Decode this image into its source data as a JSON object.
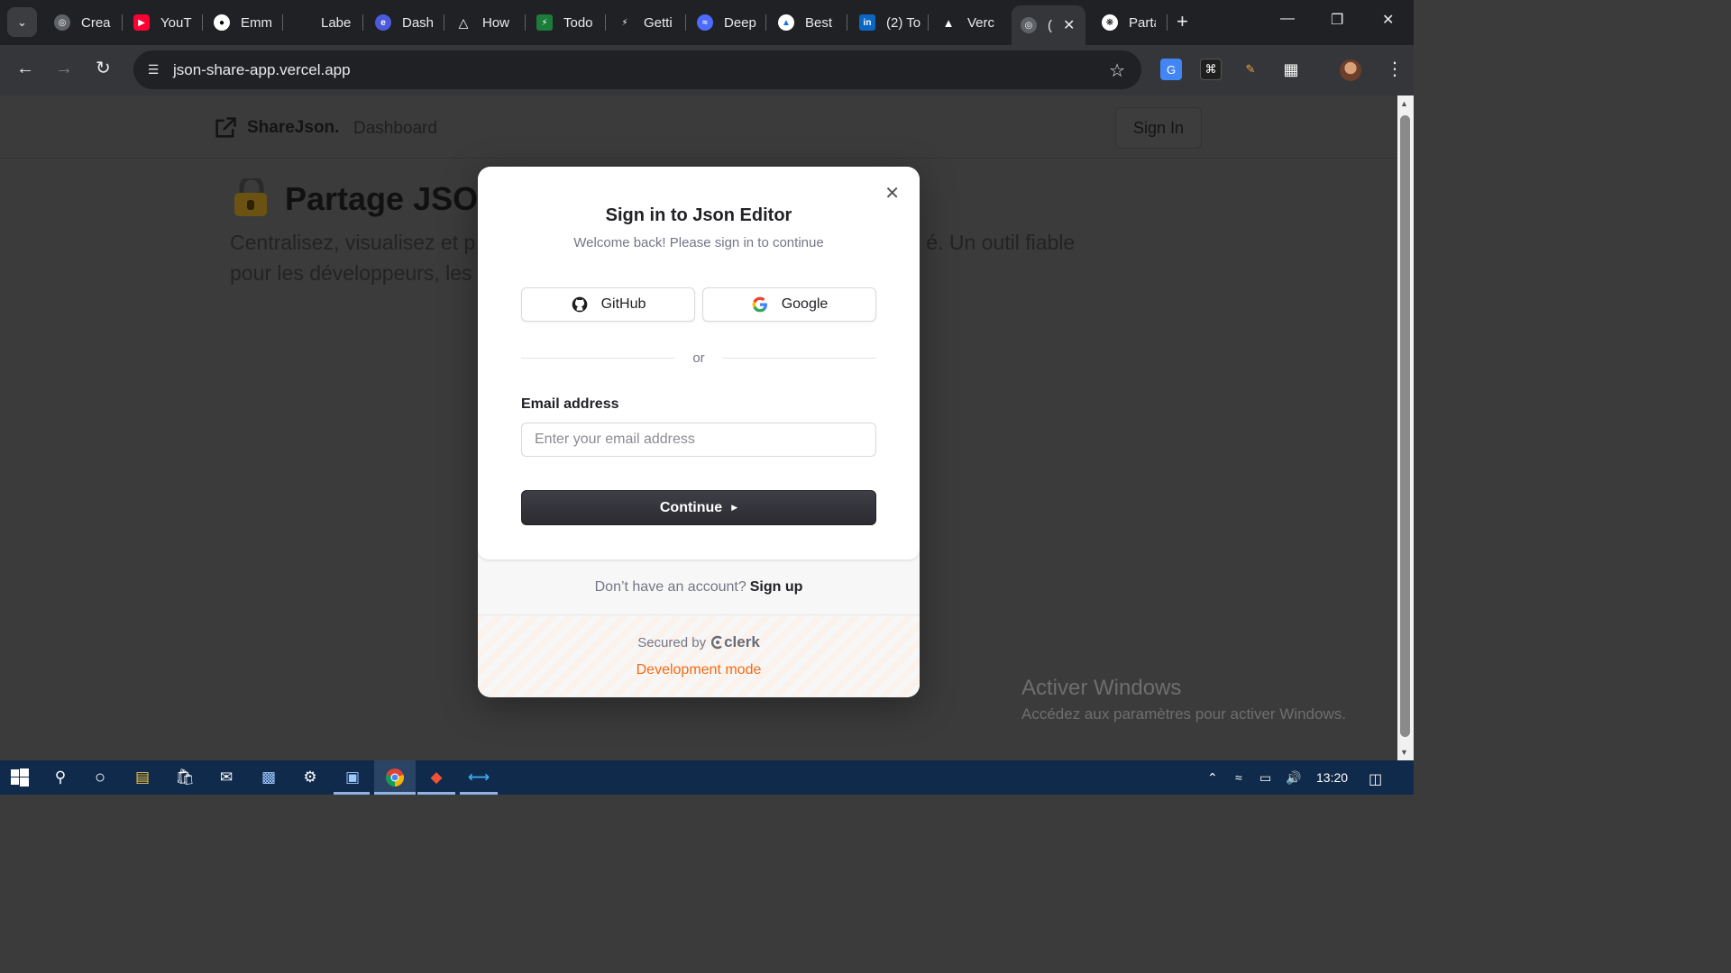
{
  "browser": {
    "tabs": [
      {
        "label": "Crea",
        "icon": "globe-icon"
      },
      {
        "label": "YouT",
        "icon": "youtube-icon"
      },
      {
        "label": "Emm",
        "icon": "github-icon"
      },
      {
        "label": "Labe",
        "icon": "blank-icon"
      },
      {
        "label": "Dash",
        "icon": "dash-icon"
      },
      {
        "label": "How",
        "icon": "triangle-icon"
      },
      {
        "label": "Todo",
        "icon": "bolt-icon"
      },
      {
        "label": "Getti",
        "icon": "bolt-icon"
      },
      {
        "label": "Deep",
        "icon": "deepseek-icon"
      },
      {
        "label": "Best",
        "icon": "drive-icon"
      },
      {
        "label": "(2) To",
        "icon": "linkedin-icon"
      },
      {
        "label": "Verc",
        "icon": "vercel-icon"
      },
      {
        "label": "(",
        "icon": "globe-icon",
        "active": true
      },
      {
        "label": "Parta",
        "icon": "openai-icon"
      }
    ],
    "url": "json-share-app.vercel.app"
  },
  "site": {
    "brand": "ShareJson.",
    "nav_dashboard": "Dashboard",
    "signin": "Sign In",
    "hero_title": "Partage JSON",
    "hero_desc_line1": "Centralisez, visualisez et p",
    "hero_desc_line1_end": "é. Un outil fiable",
    "hero_desc_line2": "pour les développeurs, les"
  },
  "modal": {
    "title": "Sign in to Json Editor",
    "subtitle": "Welcome back! Please sign in to continue",
    "github_label": "GitHub",
    "google_label": "Google",
    "divider": "or",
    "email_label": "Email address",
    "email_placeholder": "Enter your email address",
    "email_value": "",
    "continue_label": "Continue",
    "no_account": "Don’t have an account?",
    "signup_link": "Sign up",
    "secured_by": "Secured by",
    "clerk": "clerk",
    "dev_mode": "Development mode"
  },
  "watermark": {
    "title": "Activer Windows",
    "subtitle": "Accédez aux paramètres pour activer Windows."
  },
  "taskbar": {
    "clock": "13:20"
  },
  "colors": {
    "dev_mode": "#f36b16",
    "taskbar": "#0f2a4a",
    "continue": "#2f2f35"
  }
}
